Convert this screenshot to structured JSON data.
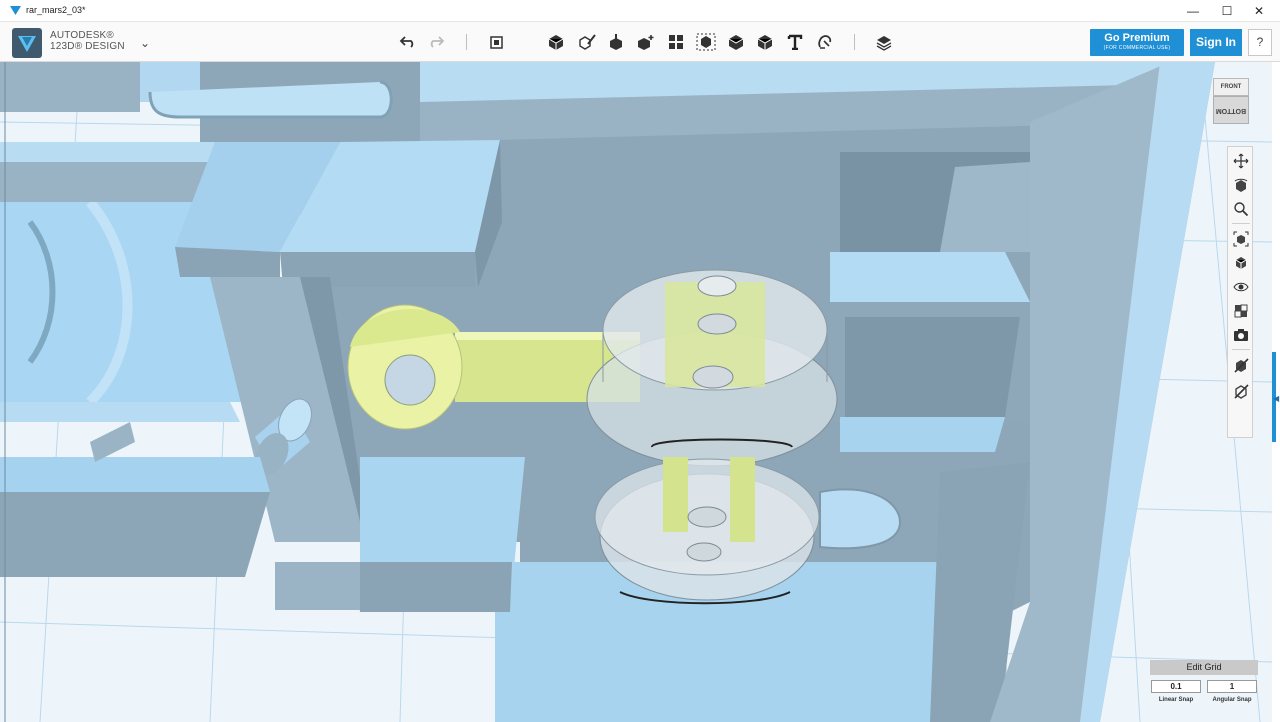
{
  "window": {
    "title": "rar_mars2_03*",
    "minimize_glyph": "—",
    "maximize_glyph": "☐",
    "close_glyph": "✕"
  },
  "header": {
    "brand_line1": "AUTODESK®",
    "brand_line2": "123D® DESIGN",
    "menu_caret": "⌄",
    "go_premium_label": "Go Premium",
    "go_premium_sub": "(FOR COMMERCIAL USE)",
    "sign_in_label": "Sign In",
    "help_label": "?"
  },
  "toolbar": {
    "tools": [
      "undo-icon",
      "redo-icon",
      "transform-icon",
      "primitives-icon",
      "sketch-icon",
      "construct-icon",
      "modify-icon",
      "pattern-icon",
      "grouping-icon",
      "combine-icon",
      "measure-icon",
      "text-icon",
      "snap-icon",
      "material-icon"
    ]
  },
  "viewcube": {
    "front_label": "FRONT",
    "bottom_label": "BOTTOM"
  },
  "nav_tools": [
    "pan-icon",
    "orbit-icon",
    "zoom-icon",
    "fit-icon",
    "views-icon",
    "visibility-icon",
    "materials-view-icon",
    "screenshot-icon",
    "hide-icon",
    "hide-all-icon"
  ],
  "grid": {
    "edit_label": "Edit Grid",
    "linear_value": "0.1",
    "angular_value": "1",
    "linear_label": "Linear Snap",
    "angular_label": "Angular Snap"
  },
  "colors": {
    "accent": "#1f8fd6",
    "part_blue": "#a5d2ef",
    "part_shadow": "#8ba6b7",
    "highlight_yellow": "#e4ef9e",
    "grid_line": "#b9d8ee"
  }
}
